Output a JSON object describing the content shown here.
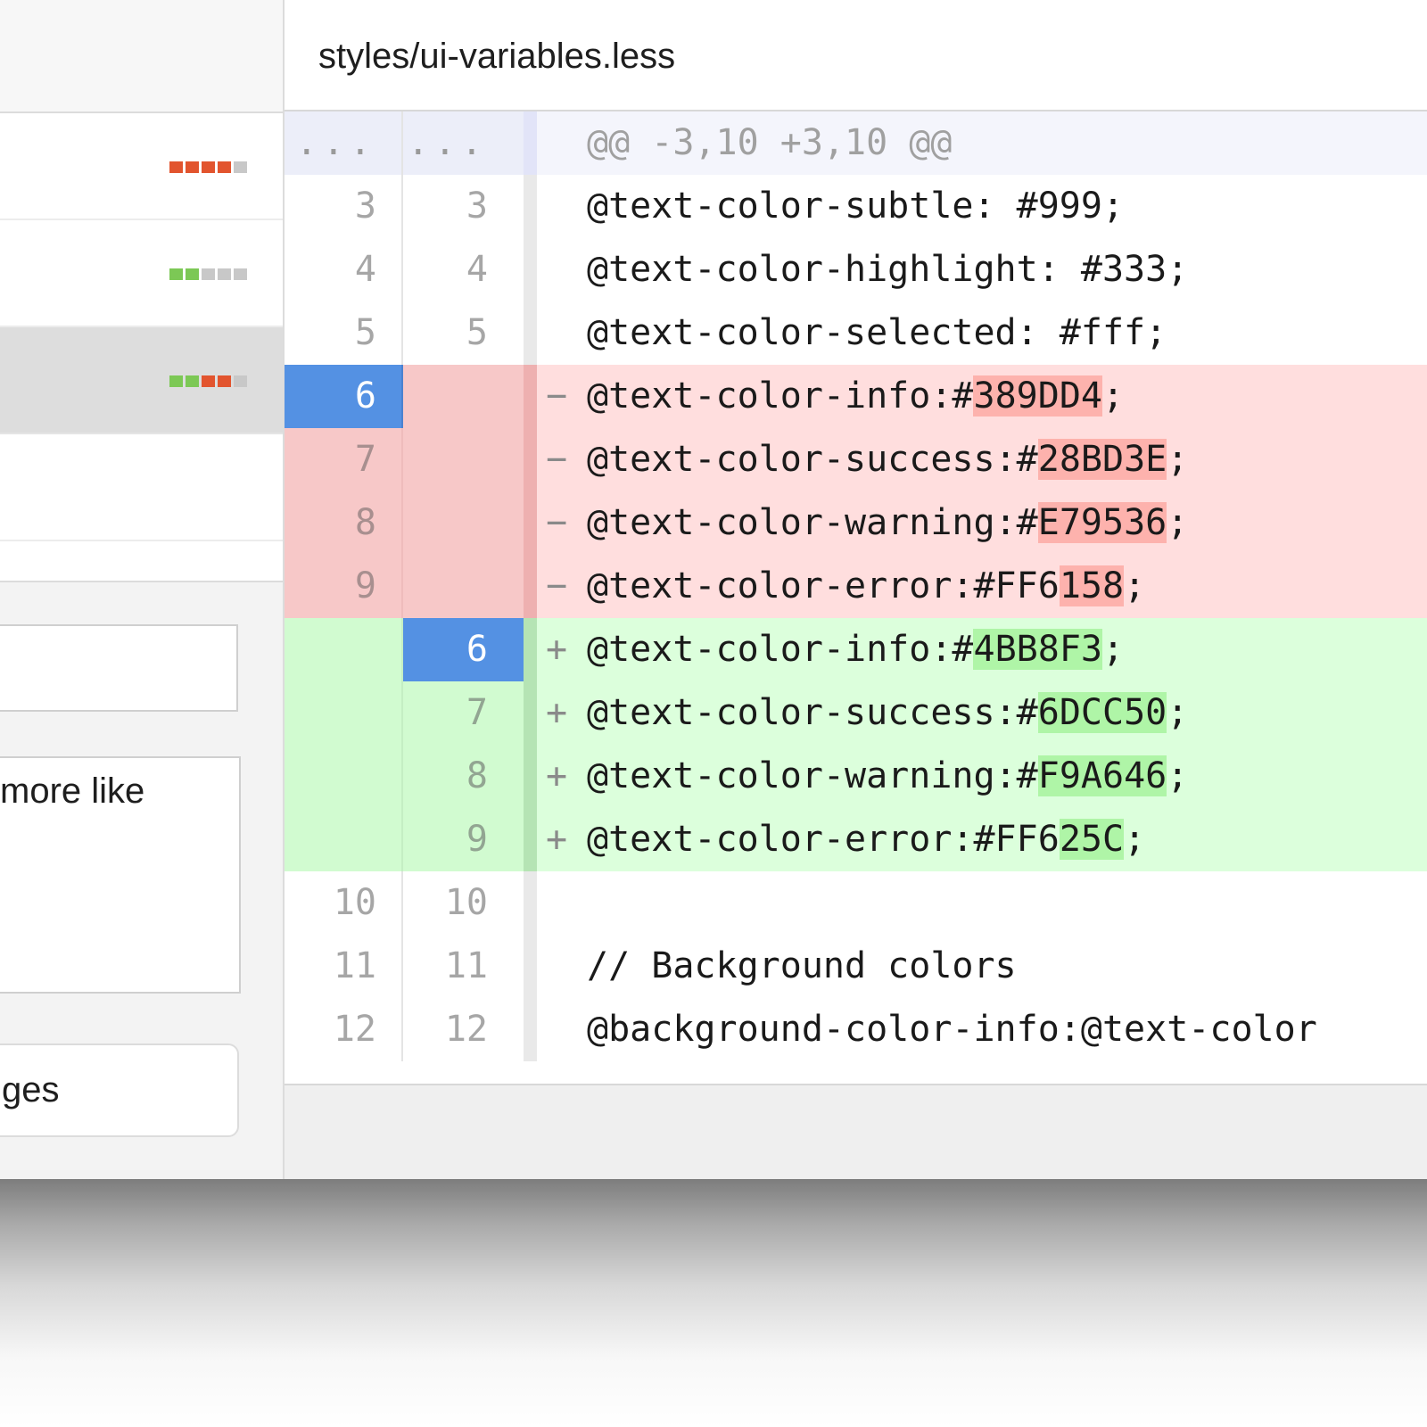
{
  "file": {
    "path": "styles/ui-variables.less"
  },
  "commits": [
    {
      "diffstat": [
        "del",
        "del",
        "del",
        "del",
        "neutral"
      ]
    },
    {
      "diffstat": [
        "add",
        "add",
        "neutral",
        "neutral",
        "neutral"
      ]
    },
    {
      "diffstat": [
        "add",
        "add",
        "del",
        "del",
        "neutral"
      ],
      "selected": true
    },
    {
      "diffstat": []
    }
  ],
  "form": {
    "summary_value": "",
    "description_value": "more like",
    "commit_button_label": "ges"
  },
  "diff": {
    "hunk": {
      "old_marker": "...",
      "new_marker": "...",
      "header": "@@ -3,10 +3,10 @@"
    },
    "lines": [
      {
        "type": "context",
        "old": "3",
        "new": "3",
        "marker": "",
        "code": [
          {
            "t": "@text-color-subtle: #999;"
          }
        ]
      },
      {
        "type": "context",
        "old": "4",
        "new": "4",
        "marker": "",
        "code": [
          {
            "t": "@text-color-highlight: #333;"
          }
        ]
      },
      {
        "type": "context",
        "old": "5",
        "new": "5",
        "marker": "",
        "code": [
          {
            "t": "@text-color-selected: #fff;"
          }
        ]
      },
      {
        "type": "del",
        "old": "6",
        "new": "",
        "marker": "−",
        "selected": true,
        "code": [
          {
            "t": "@text-color-info:#"
          },
          {
            "t": "389DD4",
            "hl": true
          },
          {
            "t": ";"
          }
        ]
      },
      {
        "type": "del",
        "old": "7",
        "new": "",
        "marker": "−",
        "code": [
          {
            "t": "@text-color-success:#"
          },
          {
            "t": "28BD3E",
            "hl": true
          },
          {
            "t": ";"
          }
        ]
      },
      {
        "type": "del",
        "old": "8",
        "new": "",
        "marker": "−",
        "code": [
          {
            "t": "@text-color-warning:#"
          },
          {
            "t": "E79536",
            "hl": true
          },
          {
            "t": ";"
          }
        ]
      },
      {
        "type": "del",
        "old": "9",
        "new": "",
        "marker": "−",
        "code": [
          {
            "t": "@text-color-error:#FF6"
          },
          {
            "t": "158",
            "hl": true
          },
          {
            "t": ";"
          }
        ]
      },
      {
        "type": "add",
        "old": "",
        "new": "6",
        "marker": "+",
        "selected": true,
        "code": [
          {
            "t": "@text-color-info:#"
          },
          {
            "t": "4BB8F3",
            "hl": true
          },
          {
            "t": ";"
          }
        ]
      },
      {
        "type": "add",
        "old": "",
        "new": "7",
        "marker": "+",
        "code": [
          {
            "t": "@text-color-success:#"
          },
          {
            "t": "6DCC50",
            "hl": true
          },
          {
            "t": ";"
          }
        ]
      },
      {
        "type": "add",
        "old": "",
        "new": "8",
        "marker": "+",
        "code": [
          {
            "t": "@text-color-warning:#"
          },
          {
            "t": "F9A646",
            "hl": true
          },
          {
            "t": ";"
          }
        ]
      },
      {
        "type": "add",
        "old": "",
        "new": "9",
        "marker": "+",
        "code": [
          {
            "t": "@text-color-error:#FF6"
          },
          {
            "t": "25C",
            "hl": true
          },
          {
            "t": ";"
          }
        ]
      },
      {
        "type": "context",
        "old": "10",
        "new": "10",
        "marker": "",
        "code": []
      },
      {
        "type": "context",
        "old": "11",
        "new": "11",
        "marker": "",
        "code": [
          {
            "t": "// Background colors"
          }
        ]
      },
      {
        "type": "context",
        "old": "12",
        "new": "12",
        "marker": "",
        "code": [
          {
            "t": "@background-color-info:@text-color"
          }
        ]
      }
    ]
  },
  "colors": {
    "selected_line_number": "#5491E3",
    "deletion_background": "#FFDEDE",
    "deletion_highlight": "#FDB2AD",
    "addition_background": "#DCFFDC",
    "addition_highlight": "#AFF5A7",
    "diffstat_deleted": "#E2542E",
    "diffstat_added": "#7CC855",
    "diffstat_neutral": "#C8C8C8"
  }
}
